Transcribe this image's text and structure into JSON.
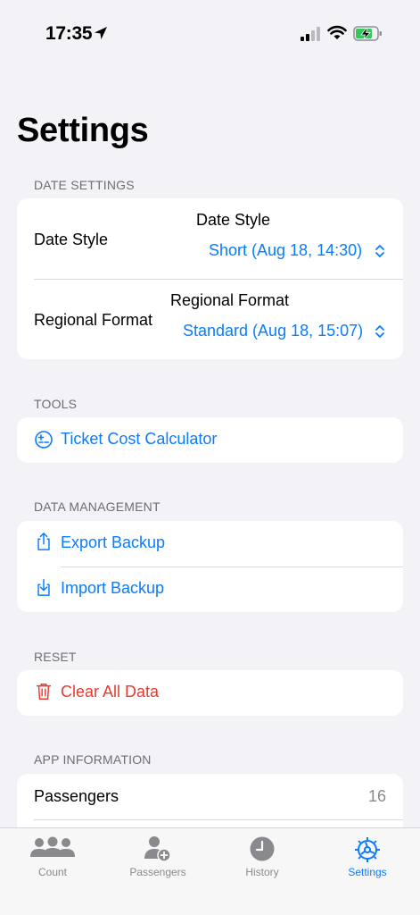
{
  "status_bar": {
    "time": "17:35"
  },
  "page_title": "Settings",
  "sections": {
    "date_settings": {
      "header": "DATE SETTINGS",
      "date_style": {
        "label": "Date Style",
        "picker_title": "Date Style",
        "value": "Short (Aug 18, 14:30)"
      },
      "regional_format": {
        "label": "Regional Format",
        "picker_title": "Regional Format",
        "value": "Standard (Aug 18, 15:07)"
      }
    },
    "tools": {
      "header": "TOOLS",
      "ticket_calc": {
        "label": "Ticket Cost Calculator",
        "icon": "plus-minus-circle-icon"
      }
    },
    "data_management": {
      "header": "DATA MANAGEMENT",
      "export": {
        "label": "Export Backup",
        "icon": "share-icon"
      },
      "import": {
        "label": "Import Backup",
        "icon": "download-icon"
      }
    },
    "reset": {
      "header": "RESET",
      "clear": {
        "label": "Clear All Data",
        "icon": "trash-icon"
      }
    },
    "app_information": {
      "header": "APP INFORMATION",
      "passengers": {
        "label": "Passengers",
        "value": "16"
      }
    }
  },
  "tab_bar": {
    "tabs": [
      {
        "label": "Count",
        "icon": "people-group-icon"
      },
      {
        "label": "Passengers",
        "icon": "person-add-icon"
      },
      {
        "label": "History",
        "icon": "clock-icon"
      },
      {
        "label": "Settings",
        "icon": "gear-icon",
        "active": true
      }
    ]
  },
  "colors": {
    "accent": "#0a7cff",
    "destructive": "#e83a30",
    "background": "#f2f2f7",
    "secondary_text": "#8a8a8e"
  }
}
